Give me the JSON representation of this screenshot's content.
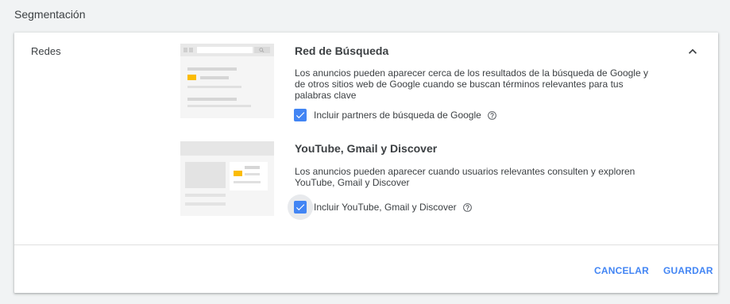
{
  "section_title": "Segmentación",
  "row_label": "Redes",
  "networks": [
    {
      "title": "Red de Búsqueda",
      "description": "Los anuncios pueden aparecer cerca de los resultados de la búsqueda de Google y de otros sitios web de Google cuando se buscan términos relevantes para tus palabras clave",
      "checkbox_label": "Incluir partners de búsqueda de Google",
      "checked": true,
      "thumbnail_icon": "search-results-illustration"
    },
    {
      "title": "YouTube, Gmail y Discover",
      "description": "Los anuncios pueden aparecer cuando usuarios relevantes consulten y exploren YouTube, Gmail y Discover",
      "checkbox_label": "Incluir YouTube, Gmail y Discover",
      "checked": true,
      "thumbnail_icon": "display-page-illustration"
    }
  ],
  "buttons": {
    "cancel": "CANCELAR",
    "save": "GUARDAR"
  },
  "colors": {
    "accent": "#4285f4",
    "highlight": "#fbbc04",
    "background": "#f1f3f4"
  }
}
